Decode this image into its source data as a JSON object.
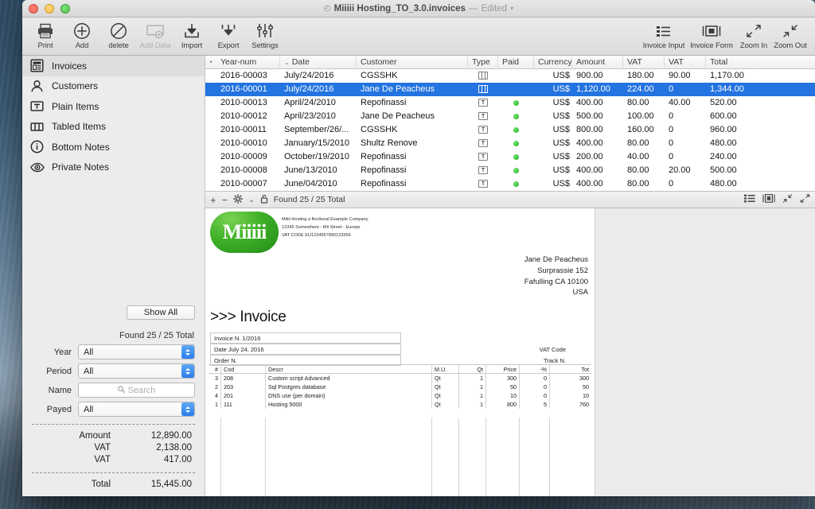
{
  "window": {
    "title": "Miiiii Hosting_TO_3.0.invoices",
    "title_separator": "—",
    "edited_label": "Edited",
    "doc_icon": "document-icon"
  },
  "toolbar_left": [
    {
      "label": "Print",
      "icon": "printer-icon",
      "disabled": false
    },
    {
      "label": "Add",
      "icon": "plus-circle-icon",
      "disabled": false
    },
    {
      "label": "delete",
      "icon": "no-entry-icon",
      "disabled": false
    },
    {
      "label": "Add Data",
      "icon": "add-data-icon",
      "disabled": true
    },
    {
      "label": "Import",
      "icon": "import-icon",
      "disabled": false
    },
    {
      "label": "Export",
      "icon": "export-icon",
      "disabled": false
    },
    {
      "label": "Settings",
      "icon": "sliders-icon",
      "disabled": false
    }
  ],
  "toolbar_right": [
    {
      "label": "Invoice Input",
      "icon": "list-icon"
    },
    {
      "label": "Invoice Form",
      "icon": "form-icon"
    },
    {
      "label": "Zoom In",
      "icon": "zoom-in-icon"
    },
    {
      "label": "Zoom Out",
      "icon": "zoom-out-icon"
    }
  ],
  "sidebar": {
    "items": [
      {
        "label": "Invoices",
        "icon": "invoice-icon",
        "selected": true
      },
      {
        "label": "Customers",
        "icon": "person-icon",
        "selected": false
      },
      {
        "label": "Plain Items",
        "icon": "text-box-icon",
        "selected": false
      },
      {
        "label": "Tabled Items",
        "icon": "columns-icon",
        "selected": false
      },
      {
        "label": "Bottom Notes",
        "icon": "info-circle-icon",
        "selected": false
      },
      {
        "label": "Private Notes",
        "icon": "eye-icon",
        "selected": false
      }
    ],
    "show_all_label": "Show All",
    "found_label": "Found 25 / 25 Total",
    "filters": [
      {
        "label": "Year",
        "type": "popup",
        "value": "All"
      },
      {
        "label": "Period",
        "type": "popup",
        "value": "All"
      },
      {
        "label": "Name",
        "type": "search",
        "value": "",
        "placeholder": "Search"
      },
      {
        "label": "Payed",
        "type": "popup",
        "value": "All"
      }
    ],
    "totals": [
      {
        "label": "Amount",
        "value": "12,890.00"
      },
      {
        "label": "VAT",
        "value": "2,138.00"
      },
      {
        "label": "VAT",
        "value": "417.00"
      }
    ],
    "grand_total": {
      "label": "Total",
      "value": "15,445.00"
    }
  },
  "list": {
    "columns": [
      "Year-num",
      "Date",
      "Customer",
      "Type",
      "Paid",
      "Currency",
      "Amount",
      "VAT",
      "VAT",
      "Total"
    ],
    "rows": [
      {
        "num": "2016-00003",
        "date": "July/24/2016",
        "customer": "CGSSHK",
        "type": "tabled",
        "paid": false,
        "currency": "US$",
        "amount": "900.00",
        "vat1": "180.00",
        "vat2": "90.00",
        "total": "1,170.00",
        "selected": false
      },
      {
        "num": "2016-00001",
        "date": "July/24/2016",
        "customer": "Jane De Peacheus",
        "type": "tabled",
        "paid": false,
        "currency": "US$",
        "amount": "1,120.00",
        "vat1": "224.00",
        "vat2": "0",
        "total": "1,344.00",
        "selected": true
      },
      {
        "num": "2010-00013",
        "date": "April/24/2010",
        "customer": "Repofinassi",
        "type": "text",
        "paid": true,
        "currency": "US$",
        "amount": "400.00",
        "vat1": "80.00",
        "vat2": "40.00",
        "total": "520.00",
        "selected": false
      },
      {
        "num": "2010-00012",
        "date": "April/23/2010",
        "customer": "Jane De Peacheus",
        "type": "text",
        "paid": true,
        "currency": "US$",
        "amount": "500.00",
        "vat1": "100.00",
        "vat2": "0",
        "total": "600.00",
        "selected": false
      },
      {
        "num": "2010-00011",
        "date": "September/26/...",
        "customer": "CGSSHK",
        "type": "text",
        "paid": true,
        "currency": "US$",
        "amount": "800.00",
        "vat1": "160.00",
        "vat2": "0",
        "total": "960.00",
        "selected": false
      },
      {
        "num": "2010-00010",
        "date": "January/15/2010",
        "customer": "Shultz Renove",
        "type": "text",
        "paid": true,
        "currency": "US$",
        "amount": "400.00",
        "vat1": "80.00",
        "vat2": "0",
        "total": "480.00",
        "selected": false
      },
      {
        "num": "2010-00009",
        "date": "October/19/2010",
        "customer": "Repofinassi",
        "type": "text",
        "paid": true,
        "currency": "US$",
        "amount": "200.00",
        "vat1": "40.00",
        "vat2": "0",
        "total": "240.00",
        "selected": false
      },
      {
        "num": "2010-00008",
        "date": "June/13/2010",
        "customer": "Repofinassi",
        "type": "text",
        "paid": true,
        "currency": "US$",
        "amount": "400.00",
        "vat1": "80.00",
        "vat2": "20.00",
        "total": "500.00",
        "selected": false
      },
      {
        "num": "2010-00007",
        "date": "June/04/2010",
        "customer": "Repofinassi",
        "type": "text",
        "paid": true,
        "currency": "US$",
        "amount": "400.00",
        "vat1": "80.00",
        "vat2": "0",
        "total": "480.00",
        "selected": false
      }
    ]
  },
  "preview_toolbar": {
    "add_label": "+",
    "remove_label": "−",
    "gear_label": "gear-icon",
    "chevron_label": "⌄",
    "lock_label": "lock-icon",
    "found_label": "Found 25 / 25 Total",
    "right_icons": [
      "list-view-icon",
      "form-view-icon",
      "zoom-out-icon",
      "zoom-in-icon"
    ]
  },
  "document": {
    "logo_text": "Miiiii",
    "company_lines": [
      "Miiiii Hosting a finctional Example Company",
      "12345 Somewhere - Mii Street - Europe",
      "VAT CODE EU1234567890123356"
    ],
    "bill_to": [
      "Jane De Peacheus",
      "Surprassie 152",
      "Fafulling CA 10100",
      "USA"
    ],
    "title": ">>> Invoice",
    "fields": [
      {
        "label": "Invoice N.  1/2016"
      },
      {
        "label": "Date July 24, 2016"
      },
      {
        "label": "Order N."
      }
    ],
    "right_labels": [
      {
        "label": "VAT Code"
      },
      {
        "label": "Track N."
      }
    ],
    "items_columns": [
      "#",
      "Cod",
      "Descr",
      "M.U.",
      "Qt",
      "Price",
      "-%",
      "Tot"
    ],
    "items": [
      {
        "n": "3",
        "cod": "208",
        "descr": "Custom script Advanced",
        "mu": "Qt",
        "qt": "1",
        "price": "300",
        "disc": "0",
        "tot": "300"
      },
      {
        "n": "2",
        "cod": "203",
        "descr": "Sql Postgres database",
        "mu": "Qt",
        "qt": "1",
        "price": "50",
        "disc": "0",
        "tot": "50"
      },
      {
        "n": "4",
        "cod": "201",
        "descr": "DNS use (per domain)",
        "mu": "Qt",
        "qt": "1",
        "price": "10",
        "disc": "0",
        "tot": "10"
      },
      {
        "n": "1",
        "cod": "111",
        "descr": "Hosting 5000",
        "mu": "Qt",
        "qt": "1",
        "price": "800",
        "disc": "5",
        "tot": "760"
      }
    ]
  },
  "colors": {
    "selection_blue": "#2373e0",
    "paid_green": "#27b327",
    "logo_green": "#41b229"
  }
}
